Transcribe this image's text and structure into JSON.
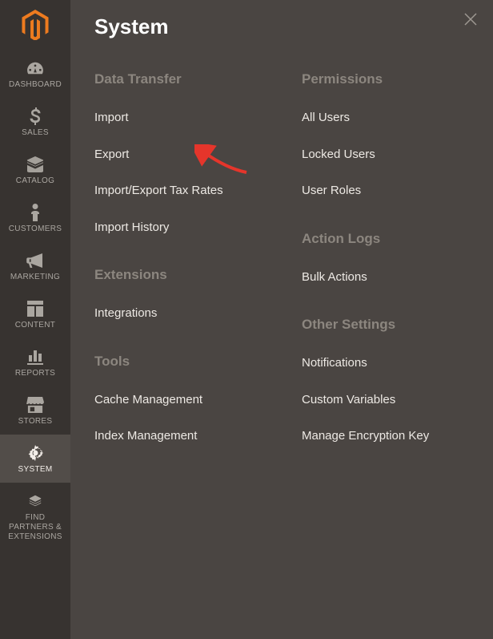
{
  "sidebar": {
    "items": [
      {
        "label": "DASHBOARD",
        "icon": "dashboard"
      },
      {
        "label": "SALES",
        "icon": "sales"
      },
      {
        "label": "CATALOG",
        "icon": "catalog"
      },
      {
        "label": "CUSTOMERS",
        "icon": "customers"
      },
      {
        "label": "MARKETING",
        "icon": "marketing"
      },
      {
        "label": "CONTENT",
        "icon": "content"
      },
      {
        "label": "REPORTS",
        "icon": "reports"
      },
      {
        "label": "STORES",
        "icon": "stores"
      },
      {
        "label": "SYSTEM",
        "icon": "system"
      },
      {
        "label": "FIND PARTNERS & EXTENSIONS",
        "icon": "partners"
      }
    ]
  },
  "flyout": {
    "title": "System",
    "left_sections": [
      {
        "title": "Data Transfer",
        "links": [
          "Import",
          "Export",
          "Import/Export Tax Rates",
          "Import History"
        ]
      },
      {
        "title": "Extensions",
        "links": [
          "Integrations"
        ]
      },
      {
        "title": "Tools",
        "links": [
          "Cache Management",
          "Index Management"
        ]
      }
    ],
    "right_sections": [
      {
        "title": "Permissions",
        "links": [
          "All Users",
          "Locked Users",
          "User Roles"
        ]
      },
      {
        "title": "Action Logs",
        "links": [
          "Bulk Actions"
        ]
      },
      {
        "title": "Other Settings",
        "links": [
          "Notifications",
          "Custom Variables",
          "Manage Encryption Key"
        ]
      }
    ]
  },
  "annotation": {
    "arrow_target": "Export"
  }
}
